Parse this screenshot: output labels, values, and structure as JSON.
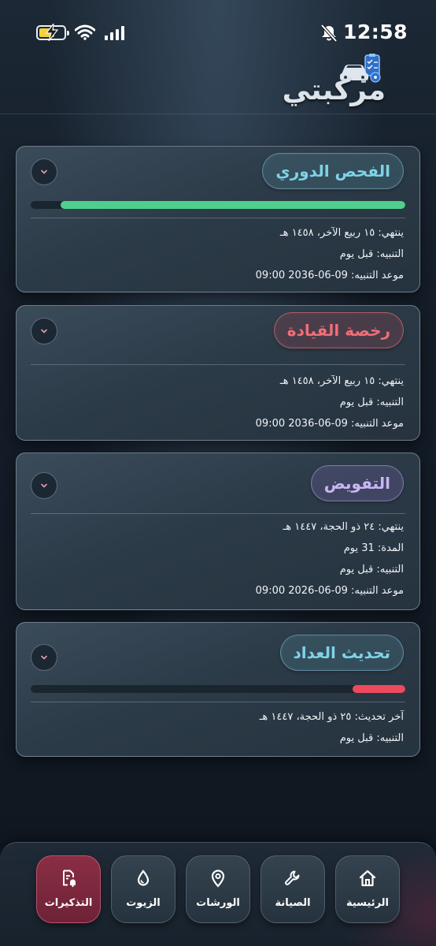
{
  "status_bar": {
    "time": "12:58"
  },
  "app": {
    "title": "مركبتي"
  },
  "cards": [
    {
      "title": "الفحص الدوري",
      "progress": 0.92,
      "progress_color": "#4fcf8d",
      "lines": [
        "ينتهي: ١٥ ربيع الآخر، ١٤٥٨ هـ",
        "التنبيه: قبل يوم",
        "موعد التنبيه: 09-06-2036 09:00"
      ]
    },
    {
      "title": "رخصة القيادة",
      "lines": [
        "ينتهي: ١٥ ربيع الآخر، ١٤٥٨ هـ",
        "التنبيه: قبل يوم",
        "موعد التنبيه: 09-06-2036 09:00"
      ]
    },
    {
      "title": "التفويض",
      "lines": [
        "ينتهي: ٢٤ ذو الحجة، ١٤٤٧ هـ",
        "المدة: 31 يوم",
        "التنبيه: قبل يوم",
        "موعد التنبيه: 09-06-2026 09:00"
      ]
    },
    {
      "title": "تحديث العداد",
      "progress": 0.14,
      "progress_color": "#ee4a5e",
      "lines": [
        "آخر تحديث: ٢٥ ذو الحجة، ١٤٤٧ هـ",
        "التنبيه: قبل يوم"
      ]
    }
  ],
  "bottom_nav": {
    "items": [
      {
        "label": "الرئيسية",
        "icon": "home-icon"
      },
      {
        "label": "الصيانة",
        "icon": "wrench-icon"
      },
      {
        "label": "الورشات",
        "icon": "map-pin-icon"
      },
      {
        "label": "الزيوت",
        "icon": "oil-drop-icon"
      },
      {
        "label": "التذكيرات",
        "icon": "reminder-document-icon",
        "active": true
      }
    ]
  },
  "colors": {
    "accent_active": "#8a2e44",
    "progress_green": "#4fcf8d",
    "progress_red": "#ee4a5e"
  }
}
